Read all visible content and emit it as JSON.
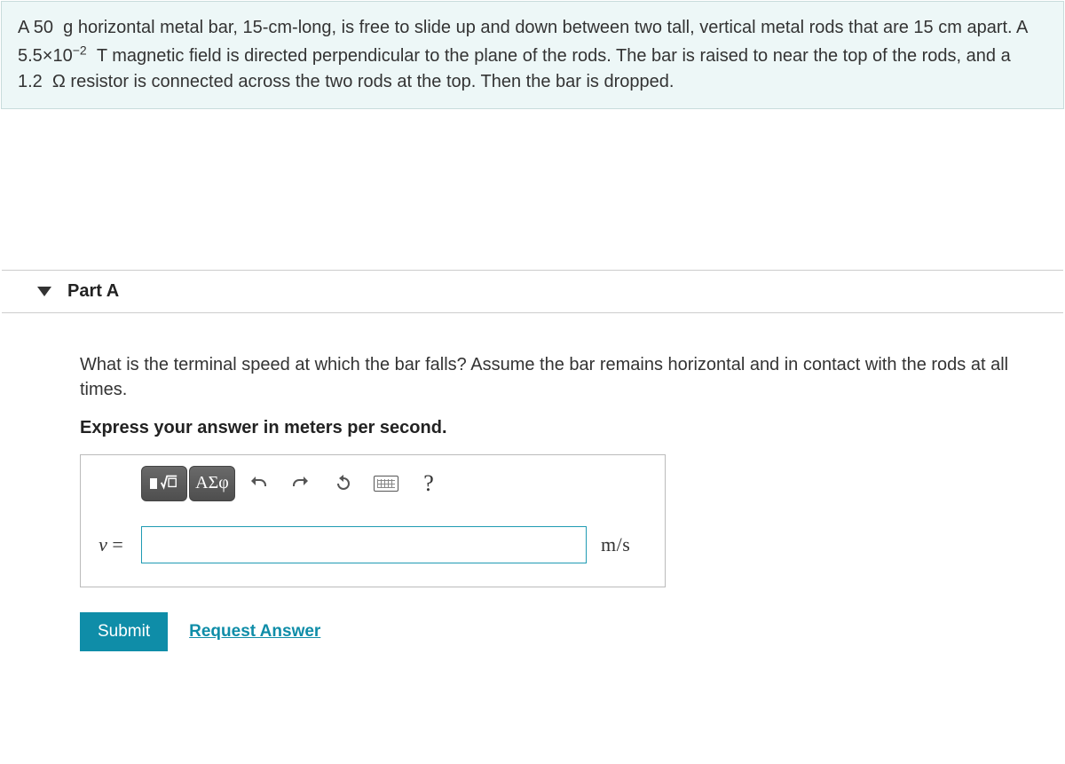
{
  "problem": {
    "html": "A 50&nbsp;&nbsp;g horizontal metal bar, 15-cm-long, is free to slide up and down between two tall, vertical metal rods that are 15 cm apart. A 5.5×10<sup>−2</sup>&nbsp;&nbsp;T magnetic field is directed perpendicular to the plane of the rods. The bar is raised to near the top of the rods, and a 1.2&nbsp;&nbsp;Ω resistor is connected across the two rods at the top. Then the bar is dropped."
  },
  "part": {
    "label": "Part A",
    "question": "What is the terminal speed at which the bar falls? Assume the bar remains horizontal and in contact with the rods at all times.",
    "instruction": "Express your answer in meters per second.",
    "toolbar": {
      "templates_icon_alt": "rect-root",
      "greek_label": "ΑΣφ"
    },
    "variable": "v",
    "equals": " = ",
    "value": "",
    "placeholder": "",
    "unit": "m/s",
    "submit_label": "Submit",
    "request_label": "Request Answer"
  }
}
